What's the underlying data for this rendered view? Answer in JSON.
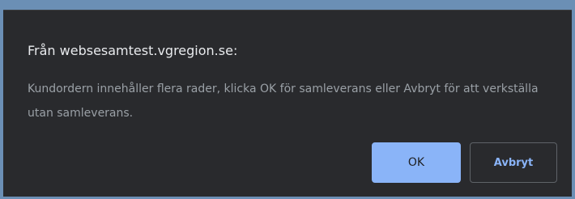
{
  "dialog": {
    "title": "Från websesamtest.vgregion.se:",
    "message": "Kundordern innehåller flera rader, klicka OK för samleverans eller Avbryt för att verkställa utan samleverans.",
    "ok_label": "OK",
    "cancel_label": "Avbryt"
  },
  "colors": {
    "dialog_background": "#292a2d",
    "title_text": "#e8eaed",
    "message_text": "#9aa0a6",
    "accent": "#8ab4f8",
    "page_background": "#6b8fb5"
  }
}
